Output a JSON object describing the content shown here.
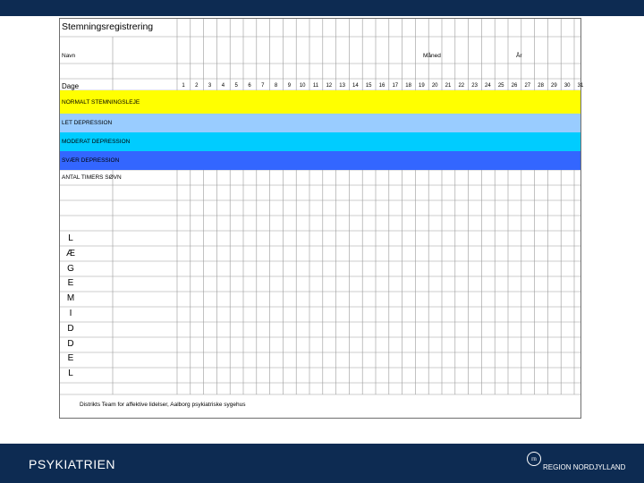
{
  "form": {
    "title": "Stemningsregistrering",
    "name_label": "Navn",
    "month_label": "Måned",
    "year_label": "År",
    "days_label": "Dage",
    "days": [
      "1",
      "2",
      "3",
      "4",
      "5",
      "6",
      "7",
      "8",
      "9",
      "10",
      "11",
      "12",
      "13",
      "14",
      "15",
      "16",
      "17",
      "18",
      "19",
      "20",
      "21",
      "22",
      "23",
      "24",
      "25",
      "26",
      "27",
      "28",
      "29",
      "30",
      "31"
    ],
    "bands": [
      {
        "label": "NORMALT STEMNINGSLEJE",
        "color": "#ffff00"
      },
      {
        "label": "LET DEPRESSION",
        "color": "#99ccff"
      },
      {
        "label": "MODERAT DEPRESSION",
        "color": "#00ccff"
      },
      {
        "label": "SVÆR DEPRESSION",
        "color": "#3366ff"
      }
    ],
    "sleep_label": "ANTAL TIMERS SØVN",
    "vertical_letters": [
      "L",
      "Æ",
      "G",
      "E",
      "M",
      "I",
      "D",
      "D",
      "E",
      "L"
    ],
    "footer_note": "Distrikts Team for affektive  lidelser, Aalborg psykiatriske sygehus"
  },
  "branding": {
    "left_text": "PSYKIATRIEN",
    "logo_text": "rn",
    "right_text": "REGION NORDJYLLAND",
    "bar_color": "#0d2b52"
  }
}
